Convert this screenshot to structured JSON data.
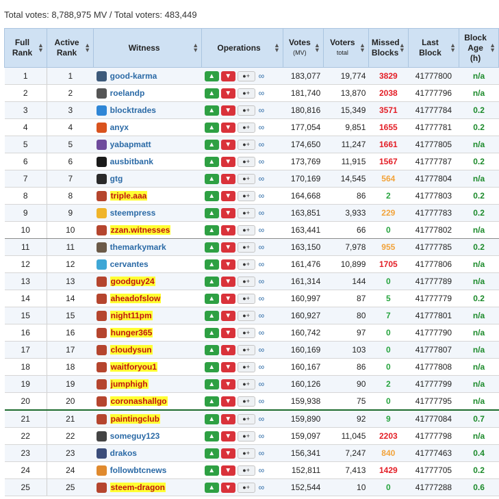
{
  "summary": "Total votes: 8,788,975 MV / Total voters: 483,449",
  "colors": {
    "header_bg": "#cfe1f3",
    "highlight": "#ffff33",
    "upvote": "#2ea043",
    "downvote": "#d9323a",
    "missed_red": "#e31d25",
    "missed_orange": "#f2a33a",
    "missed_green": "#27a43f"
  },
  "headers": {
    "full_rank": "Full Rank",
    "active_rank": "Active Rank",
    "witness": "Witness",
    "operations": "Operations",
    "votes": "Votes",
    "votes_unit": "(MV)",
    "voters": "Voters",
    "voters_sub": "total",
    "missed": "Missed Blocks",
    "last_block": "Last Block",
    "block_age": "Block Age (h)"
  },
  "icons": {
    "sort": "sort-icon",
    "thumbs_up": "thumbs-up-icon",
    "thumbs_down": "thumbs-down-icon",
    "proxy": "add-user-icon",
    "link": "link-icon"
  },
  "rows": [
    {
      "full": "1",
      "active": "1",
      "name": "good-karma",
      "highlight": false,
      "avatar": "#3d5a7a",
      "votes": "183,077",
      "voters": "19,774",
      "missed": "3829",
      "mc": "red",
      "last": "41777800",
      "age": "n/a"
    },
    {
      "full": "2",
      "active": "2",
      "name": "roelandp",
      "highlight": false,
      "avatar": "#555555",
      "votes": "181,740",
      "voters": "13,870",
      "missed": "2038",
      "mc": "red",
      "last": "41777796",
      "age": "n/a"
    },
    {
      "full": "3",
      "active": "3",
      "name": "blocktrades",
      "highlight": false,
      "avatar": "#2f86d6",
      "votes": "180,816",
      "voters": "15,349",
      "missed": "3571",
      "mc": "red",
      "last": "41777784",
      "age": "0.2"
    },
    {
      "full": "4",
      "active": "4",
      "name": "anyx",
      "highlight": false,
      "avatar": "#d9531e",
      "votes": "177,054",
      "voters": "9,851",
      "missed": "1655",
      "mc": "red",
      "last": "41777781",
      "age": "0.2"
    },
    {
      "full": "5",
      "active": "5",
      "name": "yabapmatt",
      "highlight": false,
      "avatar": "#6f4b9c",
      "votes": "174,650",
      "voters": "11,247",
      "missed": "1661",
      "mc": "red",
      "last": "41777805",
      "age": "n/a"
    },
    {
      "full": "6",
      "active": "6",
      "name": "ausbitbank",
      "highlight": false,
      "avatar": "#1a1a1a",
      "votes": "173,769",
      "voters": "11,915",
      "missed": "1567",
      "mc": "red",
      "last": "41777787",
      "age": "0.2"
    },
    {
      "full": "7",
      "active": "7",
      "name": "gtg",
      "highlight": false,
      "avatar": "#2a2a2a",
      "votes": "170,169",
      "voters": "14,545",
      "missed": "564",
      "mc": "orange",
      "last": "41777804",
      "age": "n/a"
    },
    {
      "full": "8",
      "active": "8",
      "name": "triple.aaa",
      "highlight": true,
      "avatar": "#b5452e",
      "votes": "164,668",
      "voters": "86",
      "missed": "2",
      "mc": "green",
      "last": "41777803",
      "age": "0.2"
    },
    {
      "full": "9",
      "active": "9",
      "name": "steempress",
      "highlight": false,
      "avatar": "#f0b429",
      "votes": "163,851",
      "voters": "3,933",
      "missed": "229",
      "mc": "orange",
      "last": "41777783",
      "age": "0.2"
    },
    {
      "full": "10",
      "active": "10",
      "name": "zzan.witnesses",
      "highlight": true,
      "avatar": "#b5452e",
      "votes": "163,441",
      "voters": "66",
      "missed": "0",
      "mc": "green",
      "last": "41777802",
      "age": "n/a"
    },
    {
      "full": "11",
      "active": "11",
      "name": "themarkymark",
      "highlight": false,
      "avatar": "#6b5a48",
      "votes": "163,150",
      "voters": "7,978",
      "missed": "955",
      "mc": "orange",
      "last": "41777785",
      "age": "0.2"
    },
    {
      "full": "12",
      "active": "12",
      "name": "cervantes",
      "highlight": false,
      "avatar": "#3fa7d6",
      "votes": "161,476",
      "voters": "10,899",
      "missed": "1705",
      "mc": "red",
      "last": "41777806",
      "age": "n/a"
    },
    {
      "full": "13",
      "active": "13",
      "name": "goodguy24",
      "highlight": true,
      "avatar": "#b5452e",
      "votes": "161,314",
      "voters": "144",
      "missed": "0",
      "mc": "green",
      "last": "41777789",
      "age": "n/a"
    },
    {
      "full": "14",
      "active": "14",
      "name": "aheadofslow",
      "highlight": true,
      "avatar": "#b5452e",
      "votes": "160,997",
      "voters": "87",
      "missed": "5",
      "mc": "green",
      "last": "41777779",
      "age": "0.2"
    },
    {
      "full": "15",
      "active": "15",
      "name": "night11pm",
      "highlight": true,
      "avatar": "#b5452e",
      "votes": "160,927",
      "voters": "80",
      "missed": "7",
      "mc": "green",
      "last": "41777801",
      "age": "n/a"
    },
    {
      "full": "16",
      "active": "16",
      "name": "hunger365",
      "highlight": true,
      "avatar": "#b5452e",
      "votes": "160,742",
      "voters": "97",
      "missed": "0",
      "mc": "green",
      "last": "41777790",
      "age": "n/a"
    },
    {
      "full": "17",
      "active": "17",
      "name": "cloudysun",
      "highlight": true,
      "avatar": "#b5452e",
      "votes": "160,169",
      "voters": "103",
      "missed": "0",
      "mc": "green",
      "last": "41777807",
      "age": "n/a"
    },
    {
      "full": "18",
      "active": "18",
      "name": "waitforyou1",
      "highlight": true,
      "avatar": "#b5452e",
      "votes": "160,167",
      "voters": "86",
      "missed": "0",
      "mc": "green",
      "last": "41777808",
      "age": "n/a"
    },
    {
      "full": "19",
      "active": "19",
      "name": "jumphigh",
      "highlight": true,
      "avatar": "#b5452e",
      "votes": "160,126",
      "voters": "90",
      "missed": "2",
      "mc": "green",
      "last": "41777799",
      "age": "n/a"
    },
    {
      "full": "20",
      "active": "20",
      "name": "coronashallgo",
      "highlight": true,
      "avatar": "#b5452e",
      "votes": "159,938",
      "voters": "75",
      "missed": "0",
      "mc": "green",
      "last": "41777795",
      "age": "n/a"
    },
    {
      "full": "21",
      "active": "21",
      "name": "paintingclub",
      "highlight": true,
      "avatar": "#b5452e",
      "votes": "159,890",
      "voters": "92",
      "missed": "9",
      "mc": "green",
      "last": "41777084",
      "age": "0.7"
    },
    {
      "full": "22",
      "active": "22",
      "name": "someguy123",
      "highlight": false,
      "avatar": "#444444",
      "votes": "159,097",
      "voters": "11,045",
      "missed": "2203",
      "mc": "red",
      "last": "41777798",
      "age": "n/a"
    },
    {
      "full": "23",
      "active": "23",
      "name": "drakos",
      "highlight": false,
      "avatar": "#3b4d7a",
      "votes": "156,341",
      "voters": "7,247",
      "missed": "840",
      "mc": "orange",
      "last": "41777463",
      "age": "0.4"
    },
    {
      "full": "24",
      "active": "24",
      "name": "followbtcnews",
      "highlight": false,
      "avatar": "#e08a2e",
      "votes": "152,811",
      "voters": "7,413",
      "missed": "1429",
      "mc": "red",
      "last": "41777705",
      "age": "0.2"
    },
    {
      "full": "25",
      "active": "25",
      "name": "steem-dragon",
      "highlight": true,
      "avatar": "#b5452e",
      "votes": "152,544",
      "voters": "10",
      "missed": "0",
      "mc": "green",
      "last": "41777288",
      "age": "0.6"
    }
  ]
}
